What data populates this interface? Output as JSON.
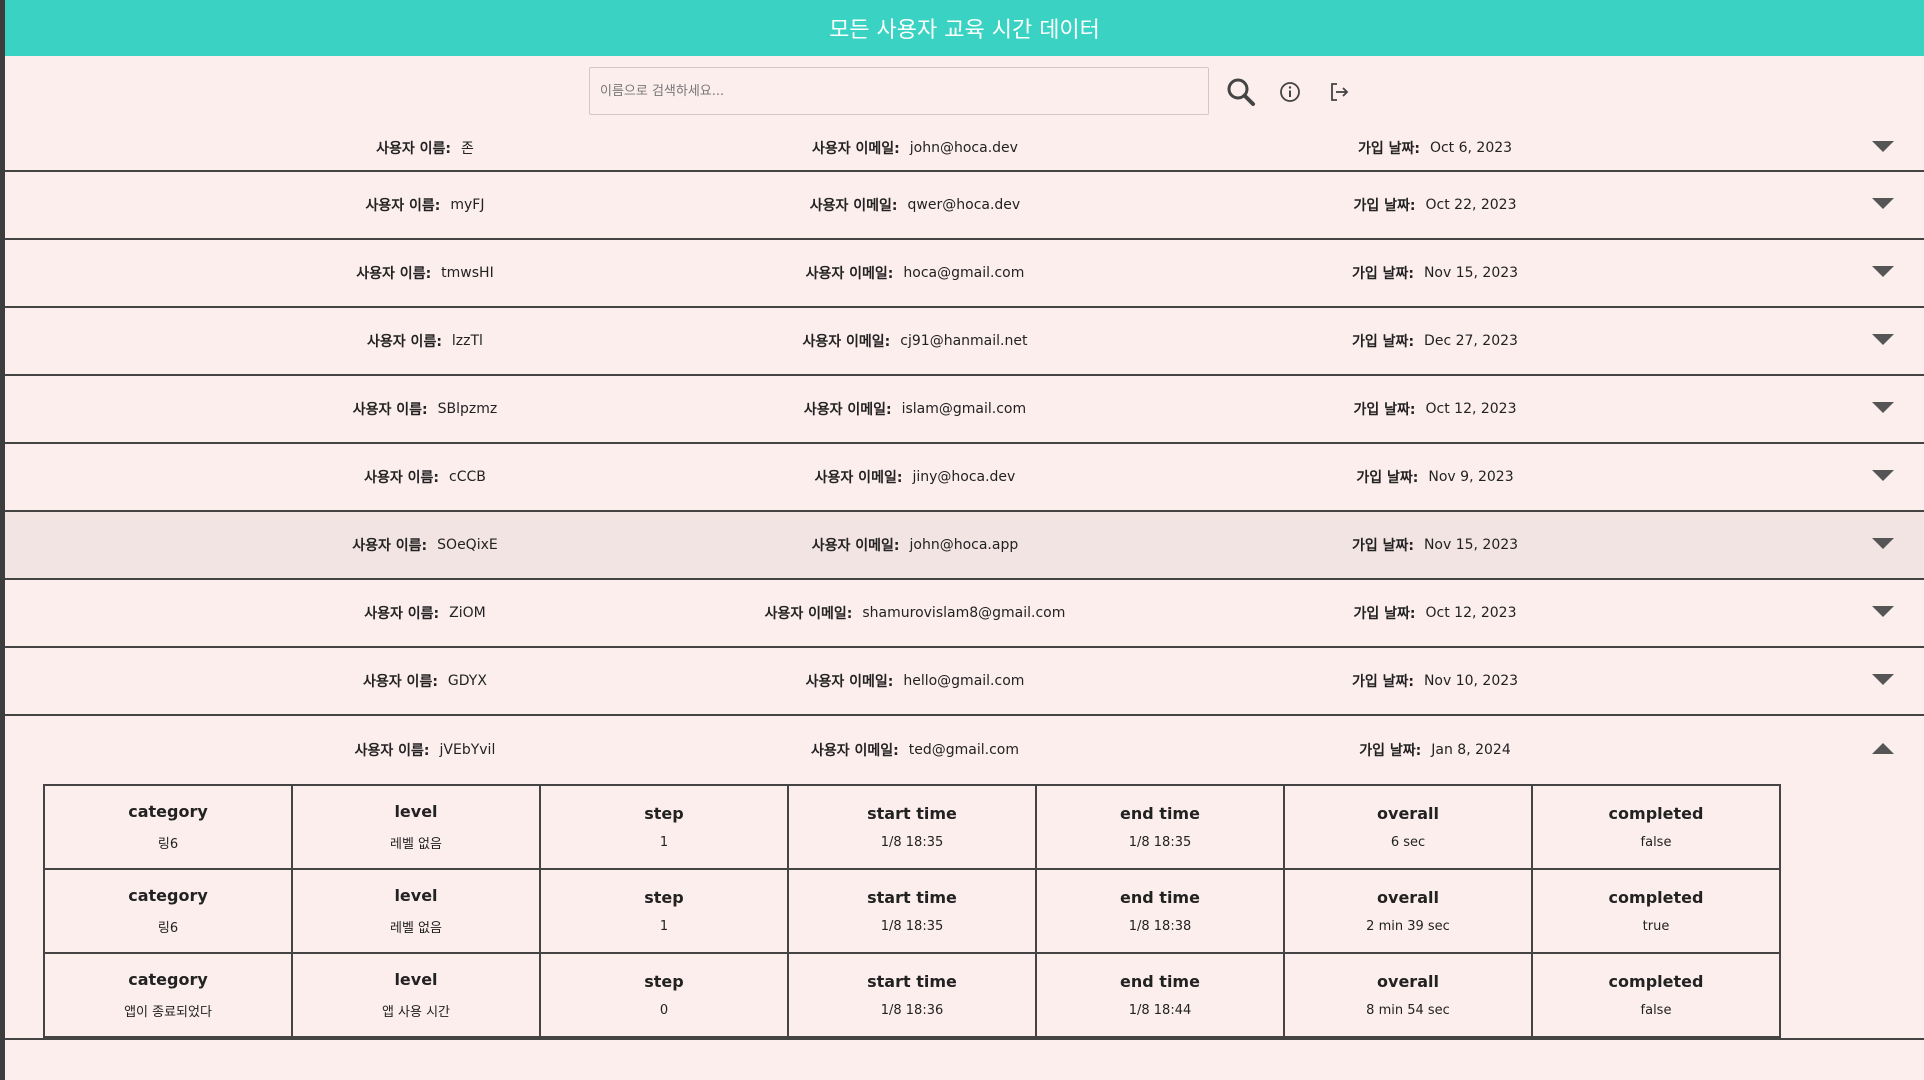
{
  "header": {
    "title": "모든 사용자 교육 시간 데이터"
  },
  "search": {
    "placeholder": "이름으로 검색하세요..."
  },
  "labels": {
    "name": "사용자 이름:",
    "email": "사용자 이메일:",
    "joined": "가입 날짜:"
  },
  "users": [
    {
      "name": "존",
      "email": "john@hoca.dev",
      "joined": "Oct 6, 2023"
    },
    {
      "name": "myFJ",
      "email": "qwer@hoca.dev",
      "joined": "Oct 22, 2023"
    },
    {
      "name": "tmwsHI",
      "email": "hoca@gmail.com",
      "joined": "Nov 15, 2023"
    },
    {
      "name": "lzzTl",
      "email": "cj91@hanmail.net",
      "joined": "Dec 27, 2023"
    },
    {
      "name": "SBlpzmz",
      "email": "islam@gmail.com",
      "joined": "Oct 12, 2023"
    },
    {
      "name": "cCCB",
      "email": "jiny@hoca.dev",
      "joined": "Nov 9, 2023"
    },
    {
      "name": "SOeQixE",
      "email": "john@hoca.app",
      "joined": "Nov 15, 2023"
    },
    {
      "name": "ZiOM",
      "email": "shamurovislam8@gmail.com",
      "joined": "Oct 12, 2023"
    },
    {
      "name": "GDYX",
      "email": "hello@gmail.com",
      "joined": "Nov 10, 2023"
    },
    {
      "name": "jVEbYvil",
      "email": "ted@gmail.com",
      "joined": "Jan 8, 2024"
    }
  ],
  "columns": [
    "category",
    "level",
    "step",
    "start time",
    "end time",
    "overall",
    "completed"
  ],
  "records": [
    [
      "링6",
      "레벨 없음",
      "1",
      "1/8 18:35",
      "1/8 18:35",
      "6 sec",
      "false"
    ],
    [
      "링6",
      "레벨 없음",
      "1",
      "1/8 18:35",
      "1/8 18:38",
      "2 min 39 sec",
      "true"
    ],
    [
      "앱이 종료되었다",
      "앱 사용 시간",
      "0",
      "1/8 18:36",
      "1/8 18:44",
      "8 min 54 sec",
      "false"
    ]
  ],
  "icons": {
    "search": "search-icon",
    "info": "info-icon",
    "logout": "logout-icon",
    "expand": "chevron-down-icon",
    "collapse": "chevron-up-icon"
  },
  "colors": {
    "header": "#3ad3c3",
    "background": "#fdeeee"
  }
}
